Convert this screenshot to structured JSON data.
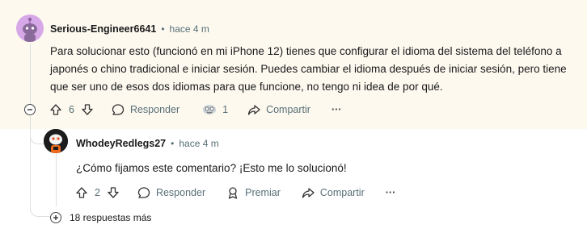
{
  "comment": {
    "author": "Serious-Engineer6641",
    "time": "hace 4 m",
    "text": "Para solucionar esto (funcionó en mi iPhone 12) tienes que configurar el idioma del sistema del teléfono a japonés o chino tradicional e iniciar sesión. Puedes cambiar el idioma después de iniciar sesión, pero tiene que ser uno de esos dos idiomas para que funcione, no tengo ni idea de por qué.",
    "votes": "6",
    "reply_label": "Responder",
    "award_count": "1",
    "share_label": "Compartir",
    "more_label": "···"
  },
  "reply": {
    "author": "WhodeyRedlegs27",
    "time": "hace 4 m",
    "text": "¿Cómo fijamos este comentario? ¡Esto me lo solucionó!",
    "votes": "2",
    "reply_label": "Responder",
    "award_label": "Premiar",
    "share_label": "Compartir",
    "more_label": "···"
  },
  "more_replies": "18 respuestas más",
  "colors": {
    "highlight": "#fdf9ef",
    "meta": "#576f76",
    "thread": "#dcdfe2",
    "avatar1": "#d7a8e8"
  }
}
